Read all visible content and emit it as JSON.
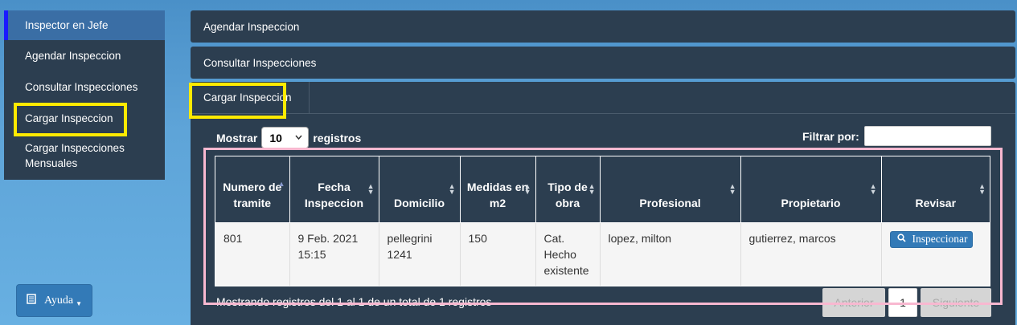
{
  "sidebar": {
    "items": [
      {
        "label": "Inspector en Jefe"
      },
      {
        "label": "Agendar Inspeccion"
      },
      {
        "label": "Consultar Inspecciones"
      },
      {
        "label": "Cargar Inspeccion"
      },
      {
        "label": "Cargar Inspecciones Mensuales"
      }
    ]
  },
  "help": {
    "label": "Ayuda",
    "icon": "book-icon"
  },
  "panels": [
    {
      "title": "Agendar Inspeccion"
    },
    {
      "title": "Consultar Inspecciones"
    },
    {
      "title": "Cargar Inspeccion"
    }
  ],
  "table_controls": {
    "show_label": "Mostrar",
    "page_size": "10",
    "records_label": "registros",
    "filter_label": "Filtrar por:",
    "filter_value": ""
  },
  "table": {
    "columns": [
      "Numero de tramite",
      "Fecha Inspeccion",
      "Domicilio",
      "Medidas en m2",
      "Tipo de obra",
      "Profesional",
      "Propietario",
      "Revisar"
    ],
    "rows": [
      {
        "numero": "801",
        "fecha": "9 Feb. 2021 15:15",
        "domicilio": "pellegrini 1241",
        "medidas": "150",
        "tipo": "Cat. Hecho existente",
        "profesional": "lopez, milton",
        "propietario": "gutierrez, marcos",
        "action": "Inspeccionar"
      }
    ]
  },
  "footer": {
    "info": "Mostrando registros del 1 al 1 de un total de 1 registros",
    "prev": "Anterior",
    "page": "1",
    "next": "Siguiente"
  },
  "colors": {
    "panel": "#2c3e50",
    "accent": "#337ab7",
    "highlight_yellow": "#ffea00",
    "highlight_pink": "#f8b8d0"
  }
}
